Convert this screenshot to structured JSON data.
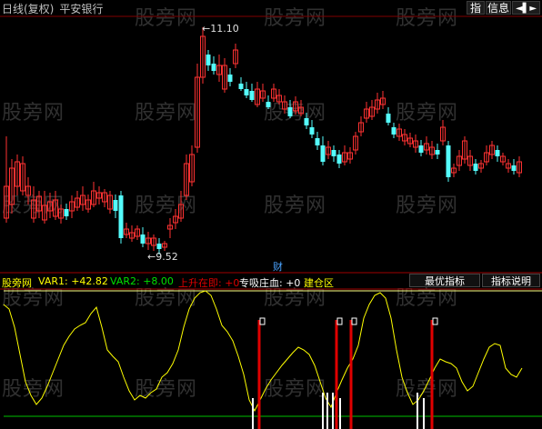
{
  "header": {
    "period": "日线(复权)",
    "stock_name": "平安银行",
    "buttons": {
      "zhi": "指",
      "info": "信息",
      "nav": "◄▌►"
    }
  },
  "watermark": "股旁网",
  "price_labels": {
    "high": "11.10",
    "low": "9.52"
  },
  "event_marker": "财",
  "indicator": {
    "name": "股旁网",
    "var1": "VAR1: +42.82",
    "var2": "VAR2: +8.00",
    "rise": "上升在即: +0",
    "absorb": "专吸庄血: +0",
    "build": "建仓区"
  },
  "indicator_buttons": {
    "best": "最优指标",
    "desc": "指标说明"
  },
  "colors": {
    "up": "#ff3232",
    "down": "#54fcfc",
    "line_yellow": "#ffff00",
    "line_green": "#00c000",
    "marker_red": "#e00000"
  }
}
